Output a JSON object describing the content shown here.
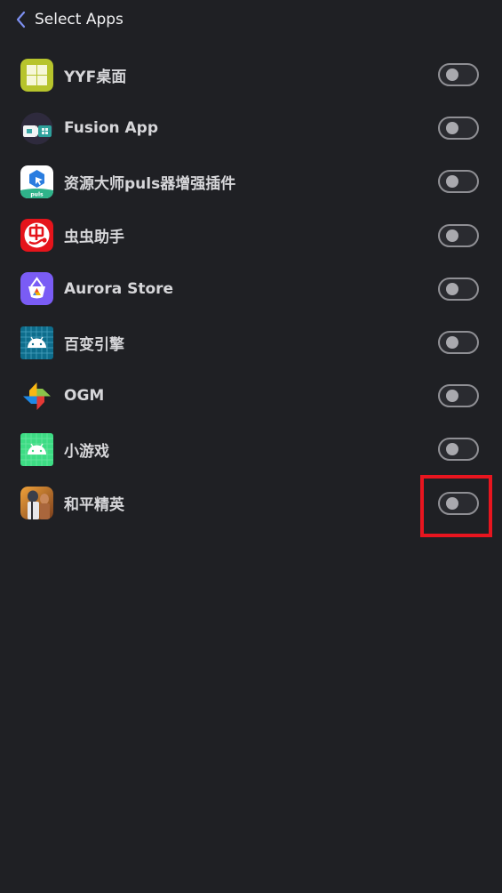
{
  "header": {
    "title": "Select Apps",
    "back_icon": "chevron-left-icon",
    "accent_color": "#7d8ff0"
  },
  "apps": [
    {
      "name": "YYF桌面",
      "icon": "yyf-launcher-icon",
      "enabled": false
    },
    {
      "name": "Fusion App",
      "icon": "fusion-app-icon",
      "enabled": false
    },
    {
      "name": "资源大师puls器增强插件",
      "icon": "resource-master-plugin-icon",
      "enabled": false
    },
    {
      "name": "虫虫助手",
      "icon": "chongchong-helper-icon",
      "enabled": false
    },
    {
      "name": "Aurora Store",
      "icon": "aurora-store-icon",
      "enabled": false
    },
    {
      "name": "百变引擎",
      "icon": "android-grid-blue-icon",
      "enabled": false
    },
    {
      "name": "OGM",
      "icon": "pinwheel-icon",
      "enabled": false
    },
    {
      "name": "小游戏",
      "icon": "android-grid-green-icon",
      "enabled": false
    },
    {
      "name": "和平精英",
      "icon": "game-for-peace-icon",
      "enabled": false
    }
  ],
  "annotation": {
    "highlight_color": "#e8151f",
    "highlighted_item": "和平精英"
  }
}
